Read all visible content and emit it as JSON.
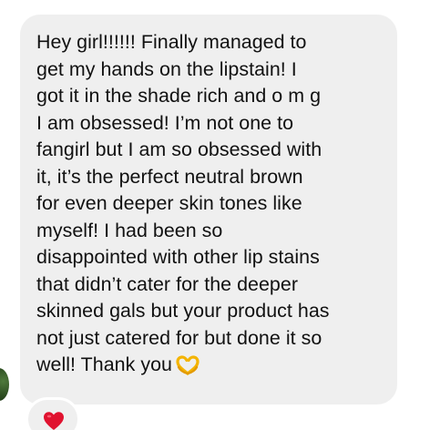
{
  "message": {
    "lines": [
      "Hey girl!!!!!! Finally managed to",
      "get my hands on the lipstain! I",
      "got it in the shade rich and o m g",
      "I am obsessed! I’m not one to",
      "fangirl but I am so obsessed with",
      "it, it’s the perfect neutral brown",
      "for even deeper skin tones like",
      "myself! I had been so",
      "disappointed with other lip stains",
      "that didn’t cater for the deeper",
      "skinned gals but your product has",
      "not just catered for but done it so",
      "well! Thank you"
    ],
    "trailing_emoji": "heart-hands-emoji",
    "bubble_color": "#efefef"
  },
  "reaction": {
    "icon": "red-heart-icon",
    "color": "#e0122f"
  },
  "sender": {
    "avatar": "avatar-icon"
  }
}
